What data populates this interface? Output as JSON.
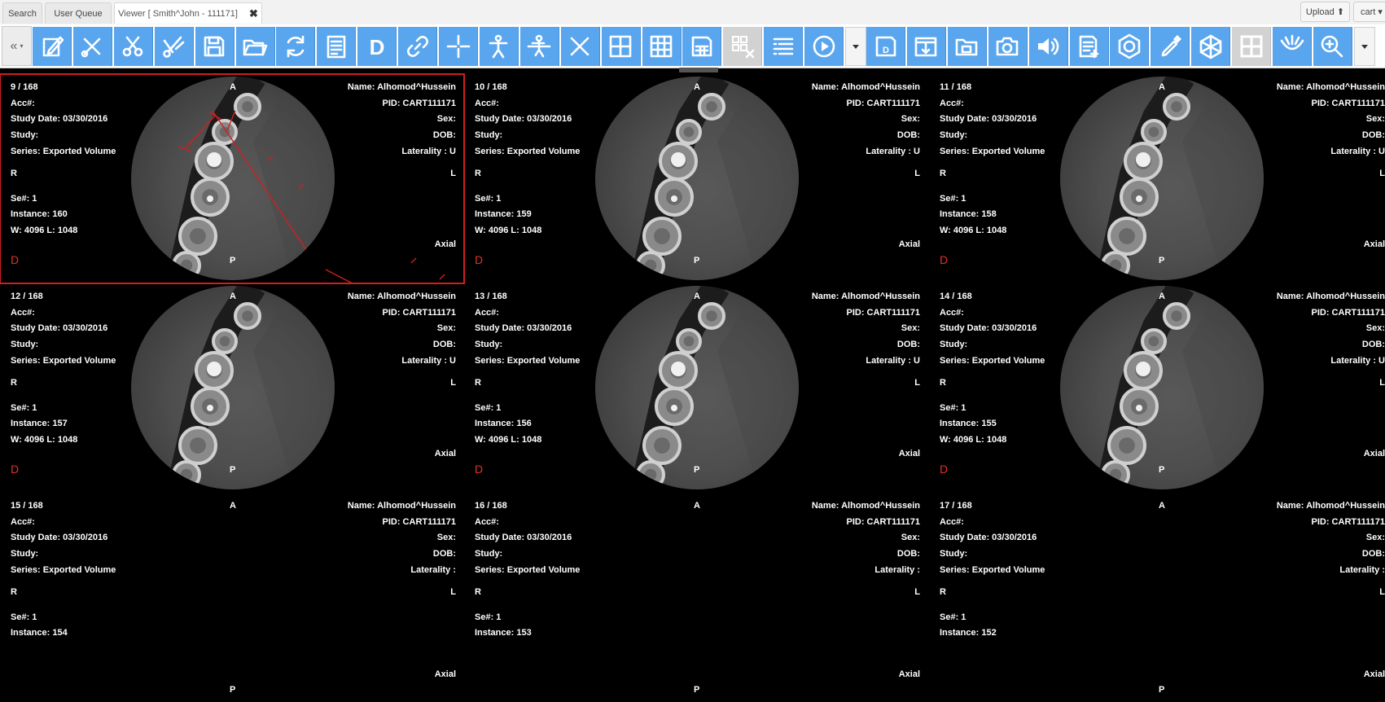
{
  "tabs": [
    {
      "label": "Search"
    },
    {
      "label": "User Queue"
    },
    {
      "label": "Viewer [ Smith^John - 111171]"
    }
  ],
  "header_buttons": {
    "upload": "Upload ⬆",
    "user": "cart ▾"
  },
  "toolbar": {
    "collapse_label": "«",
    "tools": [
      {
        "name": "pencil-annotate-icon"
      },
      {
        "name": "cut-icon"
      },
      {
        "name": "scissors-icon"
      },
      {
        "name": "scissors-multi-icon"
      },
      {
        "name": "save-icon"
      },
      {
        "name": "open-folder-icon"
      },
      {
        "name": "refresh-icon"
      },
      {
        "name": "report-icon"
      },
      {
        "name": "dental-d-icon"
      },
      {
        "name": "link-icon"
      },
      {
        "name": "crosshair-icon"
      },
      {
        "name": "body-figure-icon"
      },
      {
        "name": "body-scan-icon"
      },
      {
        "name": "trim-icon"
      },
      {
        "name": "layout-2x2-icon"
      },
      {
        "name": "layout-3x3-icon"
      },
      {
        "name": "save-layout-icon"
      },
      {
        "name": "grid-clear-icon"
      },
      {
        "name": "series-list-icon"
      },
      {
        "name": "play-cine-icon"
      },
      {
        "name": "dropdown-caret-icon"
      },
      {
        "name": "save-dicom-icon"
      },
      {
        "name": "export-icon"
      },
      {
        "name": "folder-icon"
      },
      {
        "name": "camera-icon"
      },
      {
        "name": "speaker-icon"
      },
      {
        "name": "document-add-icon"
      },
      {
        "name": "hexagon-icon"
      },
      {
        "name": "pipette-icon"
      },
      {
        "name": "3d-volume-icon"
      },
      {
        "name": "mpr-grid-icon"
      },
      {
        "name": "panoramic-curve-icon"
      },
      {
        "name": "magnifier-icon"
      },
      {
        "name": "dropdown-caret-icon"
      }
    ]
  },
  "viewports": [
    {
      "frame": "9 / 168",
      "instance": "Instance: 160",
      "wl": "W: 4096 L: 1048",
      "laterality": "Laterality : U",
      "has_image": true,
      "selected": true,
      "measure": true
    },
    {
      "frame": "10 / 168",
      "instance": "Instance: 159",
      "wl": "W: 4096 L: 1048",
      "laterality": "Laterality : U",
      "has_image": true
    },
    {
      "frame": "11 / 168",
      "instance": "Instance: 158",
      "wl": "W: 4096 L: 1048",
      "laterality": "Laterality : U",
      "has_image": true
    },
    {
      "frame": "12 / 168",
      "instance": "Instance: 157",
      "wl": "W: 4096 L: 1048",
      "laterality": "Laterality : U",
      "has_image": true
    },
    {
      "frame": "13 / 168",
      "instance": "Instance: 156",
      "wl": "W: 4096 L: 1048",
      "laterality": "Laterality : U",
      "has_image": true
    },
    {
      "frame": "14 / 168",
      "instance": "Instance: 155",
      "wl": "W: 4096 L: 1048",
      "laterality": "Laterality : U",
      "has_image": true
    },
    {
      "frame": "15 / 168",
      "instance": "Instance: 154",
      "wl": "",
      "laterality": "Laterality :",
      "has_image": false
    },
    {
      "frame": "16 / 168",
      "instance": "Instance: 153",
      "wl": "",
      "laterality": "Laterality :",
      "has_image": false
    },
    {
      "frame": "17 / 168",
      "instance": "Instance: 152",
      "wl": "",
      "laterality": "Laterality :",
      "has_image": false
    }
  ],
  "overlay_common": {
    "acc": "Acc#:",
    "study_date": "Study Date: 03/30/2016",
    "study": "Study:",
    "series": "Series: Exported Volume",
    "name": "Name: Alhomod^Hussein",
    "pid": "PID: CART111171",
    "sex": "Sex:",
    "dob": "DOB:",
    "se": "Se#: 1",
    "plane": "Axial",
    "orient_top": "A",
    "orient_bottom": "P",
    "orient_left": "R",
    "orient_right": "L",
    "marker": "D"
  },
  "colors": {
    "tool_blue": "#5aa6ee",
    "select_red": "#d21e1e"
  }
}
